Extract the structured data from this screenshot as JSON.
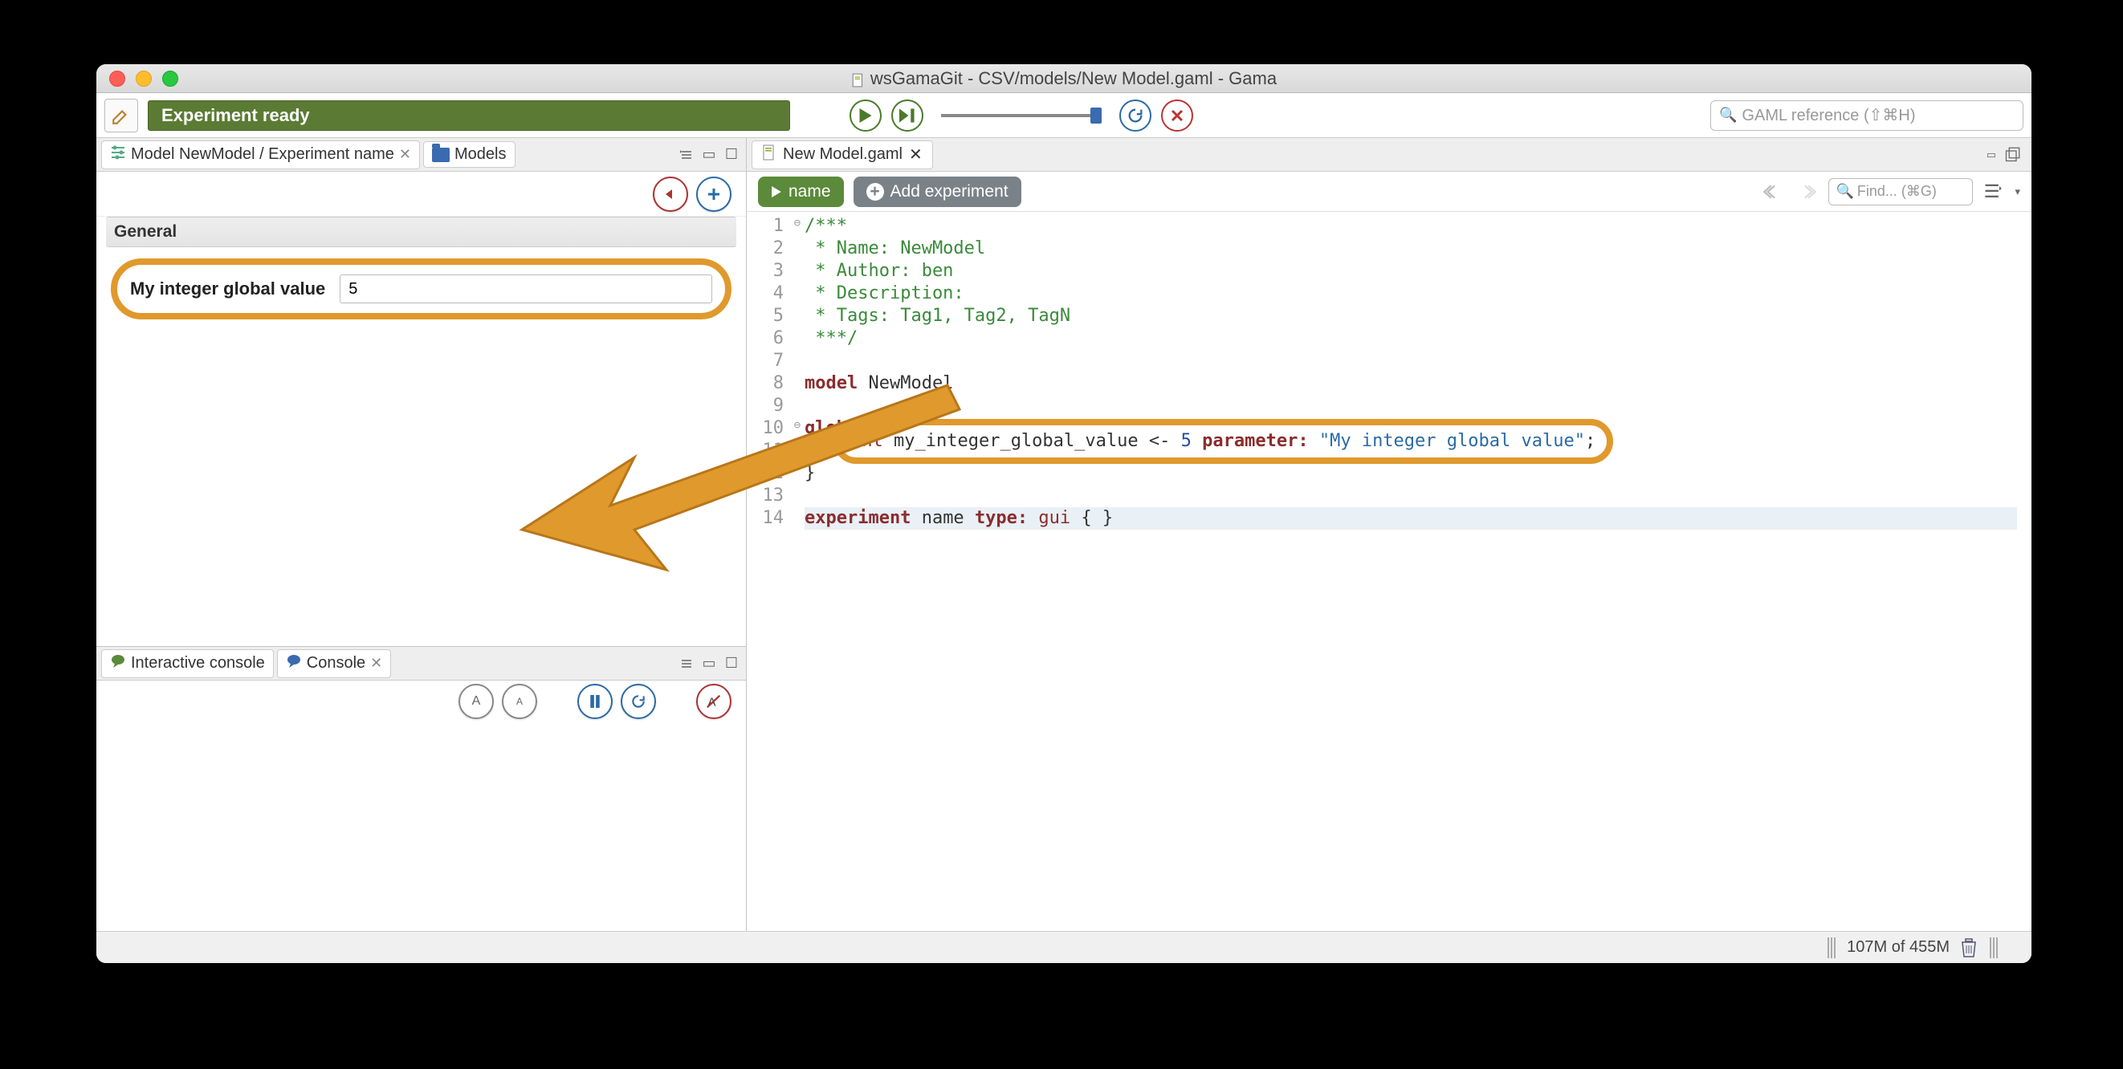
{
  "window": {
    "title": "wsGamaGit - CSV/models/New Model.gaml - Gama"
  },
  "toolbar": {
    "status": "Experiment ready",
    "search_placeholder": "GAML reference (⇧⌘H)"
  },
  "left_panel": {
    "tab_experiment": "Model NewModel / Experiment name",
    "tab_models": "Models",
    "section_general": "General",
    "param_label": "My integer global value",
    "param_value": "5"
  },
  "console": {
    "tab_interactive": "Interactive console",
    "tab_console": "Console"
  },
  "editor": {
    "tab_file": "New Model.gaml",
    "run_button": "name",
    "add_experiment": "Add experiment",
    "find_placeholder": "Find... (⌘G)",
    "line_numbers": [
      "1",
      "2",
      "3",
      "4",
      "5",
      "6",
      "7",
      "8",
      "9",
      "10",
      "11",
      "12",
      "13",
      "14"
    ],
    "code": {
      "l1": "/***",
      "l2": " * Name: NewModel",
      "l3": " * Author: ben",
      "l4": " * Description:",
      "l5": " * Tags: Tag1, Tag2, TagN",
      "l6": " ***/",
      "l7": "",
      "l8_kw": "model",
      "l8_nm": " NewModel",
      "l9": "",
      "l10_kw": "global",
      "l10_br": " {",
      "l11_type": "int",
      "l11_name": " my_integer_global_value ",
      "l11_op": "<- ",
      "l11_val": "5",
      "l11_param_kw": " parameter:",
      "l11_str": " \"My integer global value\"",
      "l11_semi": ";",
      "l12": "}",
      "l13": "",
      "l14_kw1": "experiment",
      "l14_nm": " name ",
      "l14_kw2": "type:",
      "l14_val": " gui",
      "l14_br": " { }"
    }
  },
  "footer": {
    "memory": "107M of 455M"
  }
}
